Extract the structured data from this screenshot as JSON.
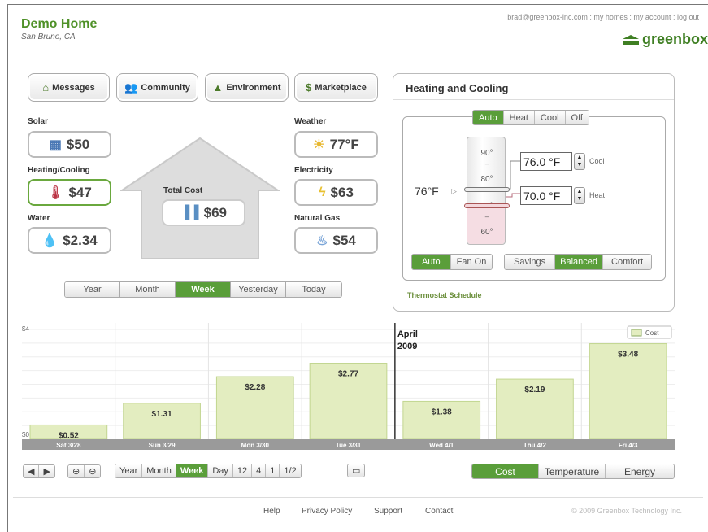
{
  "header": {
    "title": "Demo Home",
    "location": "San Bruno, CA",
    "user_email": "brad@greenbox-inc.com",
    "links": [
      ": my homes",
      ": my account",
      ": log out"
    ],
    "brand": "greenbox"
  },
  "nav": [
    {
      "label": "Messages",
      "icon": "house-icon"
    },
    {
      "label": "Community",
      "icon": "people-icon"
    },
    {
      "label": "Environment",
      "icon": "tree-icon"
    },
    {
      "label": "Marketplace",
      "icon": "dollar-icon"
    }
  ],
  "usage": {
    "solar": {
      "label": "Solar",
      "value": "$50"
    },
    "heating": {
      "label": "Heating/Cooling",
      "value": "$47"
    },
    "water": {
      "label": "Water",
      "value": "$2.34"
    },
    "total": {
      "label": "Total Cost",
      "value": "$69"
    },
    "weather": {
      "label": "Weather",
      "value": "77°F"
    },
    "electricity": {
      "label": "Electricity",
      "value": "$63"
    },
    "gas": {
      "label": "Natural Gas",
      "value": "$54"
    }
  },
  "period_tabs": [
    "Year",
    "Month",
    "Week",
    "Yesterday",
    "Today"
  ],
  "period_selected": "Week",
  "hvac": {
    "title": "Heating and Cooling",
    "modes": [
      "Auto",
      "Heat",
      "Cool",
      "Off"
    ],
    "mode_selected": "Auto",
    "current_temp": "76°F",
    "scale": [
      "90°",
      "80°",
      "70°",
      "60°"
    ],
    "cool_setpoint": "76.0 °F",
    "cool_label": "Cool",
    "heat_setpoint": "70.0 °F",
    "heat_label": "Heat",
    "fan": [
      "Auto",
      "Fan On"
    ],
    "fan_selected": "Auto",
    "profile": [
      "Savings",
      "Balanced",
      "Comfort"
    ],
    "profile_selected": "Balanced",
    "schedule_link": "Thermostat Schedule"
  },
  "chart_data": {
    "type": "bar",
    "categories": [
      "Sat 3/28",
      "Sun 3/29",
      "Mon 3/30",
      "Tue 3/31",
      "Wed 4/1",
      "Thu 4/2",
      "Fri 4/3"
    ],
    "series": [
      {
        "name": "Cost",
        "values": [
          0.52,
          1.31,
          2.28,
          2.77,
          1.38,
          2.19,
          3.48
        ]
      }
    ],
    "value_labels": [
      "$0.52",
      "$1.31",
      "$2.28",
      "$2.77",
      "$1.38",
      "$2.19",
      "$3.48"
    ],
    "ymin_label": "$0",
    "ymax_label": "$4",
    "ylim": [
      0,
      4
    ],
    "annotation": [
      "April",
      "2009"
    ],
    "legend": "top-right",
    "grid": true,
    "bar_color": "#e3edc0",
    "bar_border": "#c2d690"
  },
  "chart_controls": {
    "zoom": [
      "Year",
      "Month",
      "Week",
      "Day",
      "12",
      "4",
      "1",
      "1/2"
    ],
    "zoom_selected": "Week",
    "modes": [
      "Cost",
      "Temperature",
      "Energy"
    ],
    "mode_selected": "Cost"
  },
  "footer": {
    "links": [
      "Help",
      "Privacy Policy",
      "Support",
      "Contact"
    ],
    "copyright": "© 2009 Greenbox Technology Inc."
  },
  "colors": {
    "accent": "#5a9e3a",
    "brand": "#3f7f23"
  }
}
